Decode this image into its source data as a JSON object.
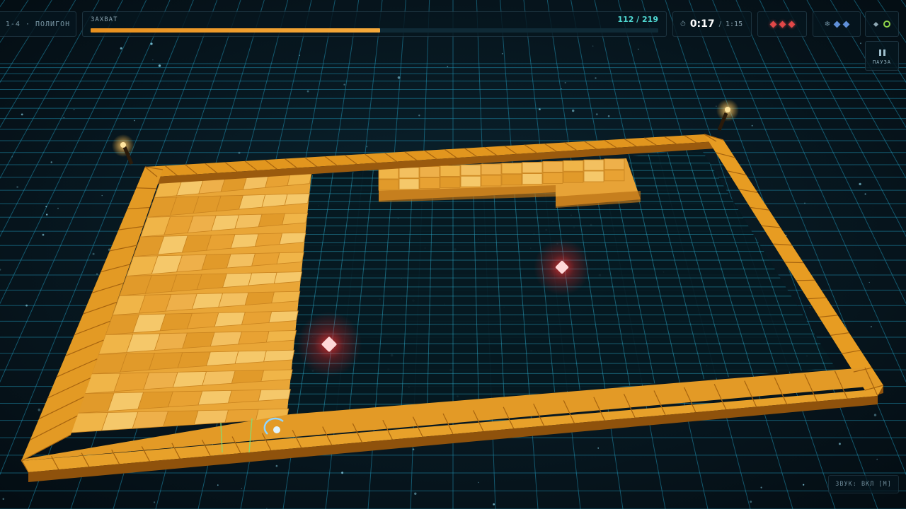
{
  "hud": {
    "level_label": "1-4 · ПОЛИГОН",
    "capture": {
      "label": "ЗАХВАТ",
      "count": "112 / 219",
      "progress": 0.51
    },
    "timer": {
      "current": "0:17",
      "separator": "/",
      "total": "1:15",
      "icon": "stopwatch-icon"
    },
    "lives": {
      "count": 3,
      "icon": "red-diamond-icon",
      "color": "#e24848"
    },
    "freeze": {
      "count": 2,
      "icon": "snowflake-icon",
      "color": "#5f8fd8"
    },
    "bonus": {
      "icons": [
        "diamond-icon",
        "green-ring-icon"
      ],
      "color": "#8fd44a"
    },
    "pause_label": "ПАУЗА",
    "sound_label": "ЗВУК: ВКЛ [M]"
  },
  "game": {
    "wall_color": "#e9a02c",
    "captured_color": "#f1b544",
    "grid_color": "#1f8fb0",
    "enemy_color": "#ff3a3a",
    "player_color": "#8fd6ff",
    "enemy_count": 2
  }
}
